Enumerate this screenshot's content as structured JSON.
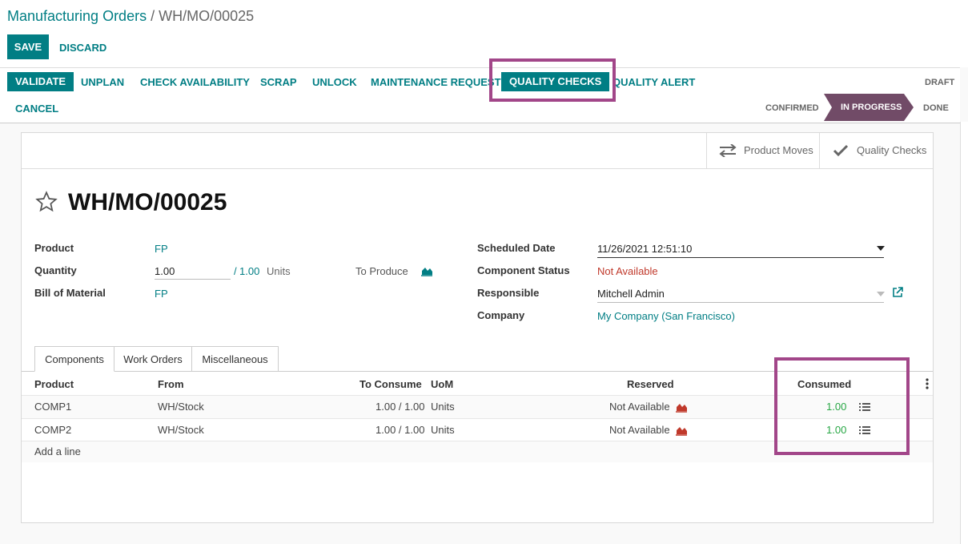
{
  "breadcrumb": {
    "parent": "Manufacturing Orders",
    "separator": "/",
    "current": "WH/MO/00025"
  },
  "control": {
    "save_label": "SAVE",
    "discard_label": "DISCARD"
  },
  "statusbar": {
    "buttons": [
      "VALIDATE",
      "UNPLAN",
      "CHECK AVAILABILITY",
      "SCRAP",
      "UNLOCK",
      "MAINTENANCE REQUEST",
      "QUALITY CHECKS",
      "QUALITY ALERT"
    ],
    "cancel_label": "CANCEL",
    "states": [
      "DRAFT",
      "CONFIRMED",
      "IN PROGRESS",
      "DONE"
    ],
    "active_state": "IN PROGRESS"
  },
  "smart_buttons": {
    "product_moves": "Product Moves",
    "quality_checks": "Quality Checks"
  },
  "record": {
    "title": "WH/MO/00025",
    "product_label": "Product",
    "product_value": "FP",
    "quantity_label": "Quantity",
    "quantity_value": "1.00",
    "quantity_separator": "/",
    "quantity_produced": "1.00",
    "quantity_uom": "Units",
    "to_produce_label": "To Produce",
    "bom_label": "Bill of Material",
    "bom_value": "FP",
    "scheduled_label": "Scheduled Date",
    "scheduled_value": "11/26/2021 12:51:10",
    "component_status_label": "Component Status",
    "component_status_value": "Not Available",
    "responsible_label": "Responsible",
    "responsible_value": "Mitchell Admin",
    "company_label": "Company",
    "company_value": "My Company (San Francisco)"
  },
  "tabs": [
    "Components",
    "Work Orders",
    "Miscellaneous"
  ],
  "table": {
    "headers": {
      "product": "Product",
      "from": "From",
      "to_consume": "To Consume",
      "uom": "UoM",
      "reserved": "Reserved",
      "consumed": "Consumed"
    },
    "rows": [
      {
        "product": "COMP1",
        "from": "WH/Stock",
        "to_consume": "1.00 / 1.00",
        "uom": "Units",
        "reserved": "Not Available",
        "consumed": "1.00"
      },
      {
        "product": "COMP2",
        "from": "WH/Stock",
        "to_consume": "1.00 / 1.00",
        "uom": "Units",
        "reserved": "Not Available",
        "consumed": "1.00"
      }
    ],
    "add_line": "Add a line"
  },
  "colors": {
    "primary": "#017e84",
    "highlight": "#a24689",
    "state_active": "#714b67",
    "danger": "#c0392b",
    "success": "#28a745"
  }
}
